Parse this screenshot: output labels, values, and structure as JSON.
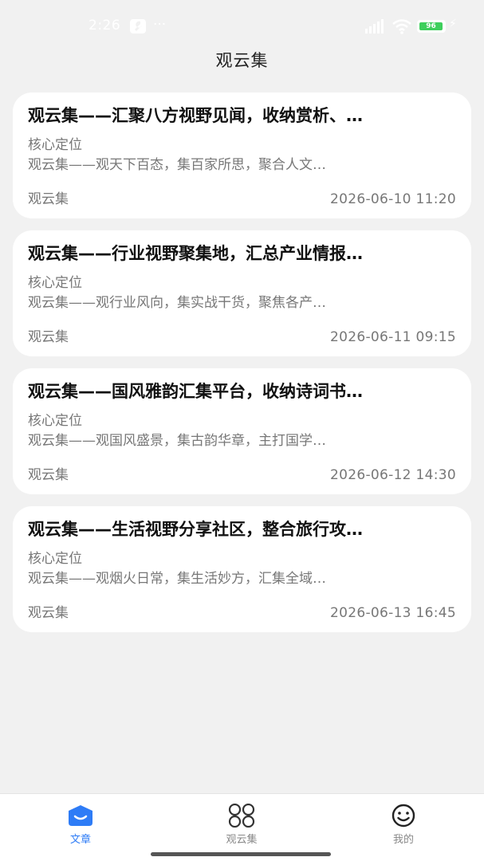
{
  "status_bar": {
    "time": "2:26",
    "more_indicator": "···",
    "battery_level": "96",
    "icons": [
      "wrench-icon",
      "signal-icon",
      "wifi-icon",
      "battery-icon",
      "charging-bolt-icon"
    ]
  },
  "header": {
    "title": "观云集"
  },
  "articles": [
    {
      "title": "观云集——汇聚八方视野见闻，收纳赏析、…",
      "subhead": "核心定位",
      "summary": "观云集——观天下百态，集百家所思，聚合人文…",
      "source": "观云集",
      "date": "2026-06-10 11:20"
    },
    {
      "title": "观云集——行业视野聚集地，汇总产业情报…",
      "subhead": "核心定位",
      "summary": "观云集——观行业风向，集实战干货，聚焦各产…",
      "source": "观云集",
      "date": "2026-06-11 09:15"
    },
    {
      "title": "观云集——国风雅韵汇集平台，收纳诗词书…",
      "subhead": "核心定位",
      "summary": "观云集——观国风盛景，集古韵华章，主打国学…",
      "source": "观云集",
      "date": "2026-06-12 14:30"
    },
    {
      "title": "观云集——生活视野分享社区，整合旅行攻…",
      "subhead": "核心定位",
      "summary": "观云集——观烟火日常，集生活妙方，汇集全域…",
      "source": "观云集",
      "date": "2026-06-13 16:45"
    }
  ],
  "tabs": [
    {
      "label": "文章",
      "icon": "article-icon",
      "active": true
    },
    {
      "label": "观云集",
      "icon": "grid-icon",
      "active": false
    },
    {
      "label": "我的",
      "icon": "smiley-icon",
      "active": false
    }
  ],
  "colors": {
    "background": "#f1f1f1",
    "card": "#ffffff",
    "accent": "#2e7cf6",
    "battery": "#3ecf5c",
    "muted_text": "#777777"
  }
}
